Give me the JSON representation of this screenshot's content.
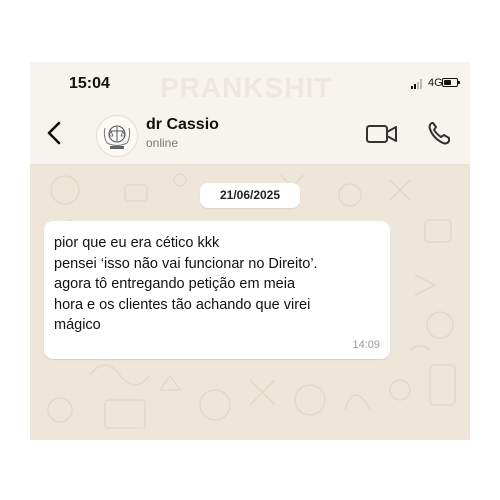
{
  "status_bar": {
    "time": "15:04",
    "watermark": "PRANKSHIT",
    "network": "4G",
    "battery_level": 0.6
  },
  "header": {
    "contact_name": "dr Cassio",
    "presence": "online",
    "icons": {
      "back": "chevron-left-icon",
      "avatar": "law-emblem-avatar",
      "video": "video-camera-icon",
      "call": "phone-icon"
    }
  },
  "chat": {
    "date_chip": "21/06/2025",
    "messages": [
      {
        "direction": "incoming",
        "lines": [
          "pior que eu era cético kkk",
          "pensei ‘isso não vai funcionar no Direito’.",
          "agora tô entregando petição em meia",
          "hora e os clientes tão achando que virei",
          "mágico"
        ],
        "time": "14:09"
      }
    ]
  },
  "colors": {
    "chat_background": "#efe6da",
    "header_background": "#f7f4ef",
    "bubble": "#ffffff",
    "text": "#111111"
  }
}
